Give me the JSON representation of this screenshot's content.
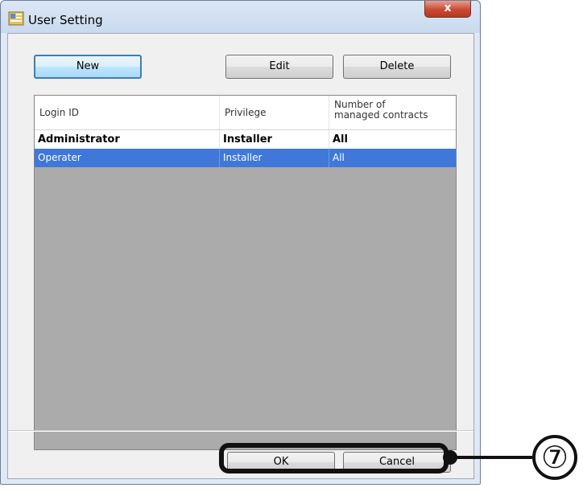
{
  "window": {
    "title": "User Setting",
    "close_label": "x"
  },
  "toolbar": {
    "new_label": "New",
    "edit_label": "Edit",
    "delete_label": "Delete"
  },
  "table": {
    "headers": [
      "Login ID",
      "Privilege",
      "Number of managed contracts"
    ],
    "header_third_line1": "Number of",
    "header_third_line2": "managed contracts",
    "rows": [
      [
        "Administrator",
        "Installer",
        "All"
      ],
      [
        "Operater",
        "Installer",
        "All"
      ]
    ],
    "selected_row": 1
  },
  "footer": {
    "ok_label": "OK",
    "cancel_label": "Cancel"
  },
  "annotation": {
    "callout_number": "⑦"
  },
  "colors": {
    "selection": "#3f78d8",
    "list_background": "#ababab",
    "close_button": "#c94a32"
  }
}
